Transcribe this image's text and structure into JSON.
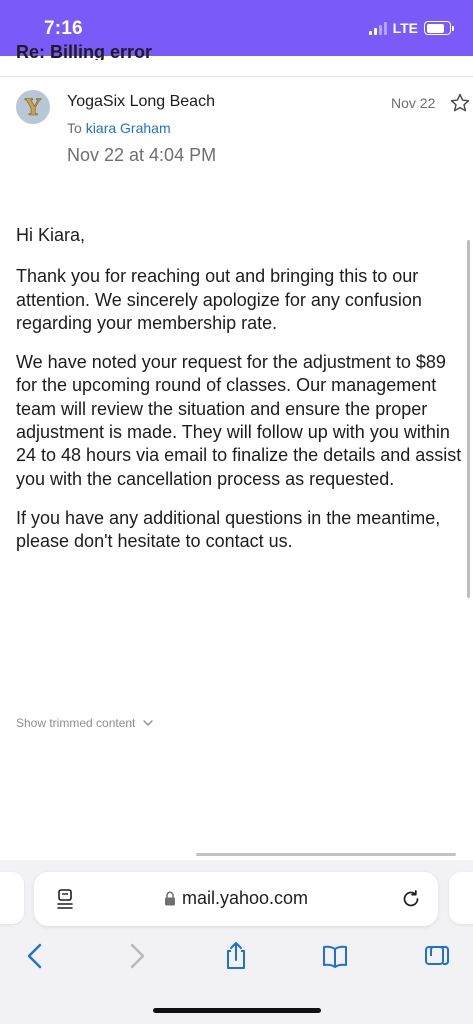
{
  "status_bar": {
    "time": "7:16",
    "network": "LTE",
    "signal_bars_active": 2,
    "signal_bars_total": 4,
    "background": "#7a5af8"
  },
  "email": {
    "subject_partial": "Re: Billing error",
    "sender": {
      "name": "YogaSix Long Beach",
      "avatar_letter": "Y"
    },
    "recipient": {
      "prefix": "To",
      "name": "kiara Graham"
    },
    "short_date": "Nov 22",
    "full_date": "Nov 22 at 4:04 PM",
    "body": {
      "greeting": "Hi Kiara,",
      "paragraphs": [
        "Thank you for reaching out and bringing this to our attention. We sincerely apologize for any confusion regarding your membership rate.",
        "We have noted your request for the adjustment to $89 for the upcoming round of classes. Our management team will review the situation and ensure the proper adjustment is made. They will follow up with you within 24 to 48 hours via email to finalize the details and assist you with the cancellation process as requested.",
        "If you have any additional questions in the meantime, please don't hesitate to contact us."
      ]
    },
    "show_trimmed_label": "Show trimmed content"
  },
  "browser": {
    "url": "mail.yahoo.com",
    "toolbar": [
      "back-icon",
      "forward-icon",
      "share-icon",
      "bookmarks-icon",
      "tabs-icon"
    ],
    "accent": "#1f6fd8"
  }
}
